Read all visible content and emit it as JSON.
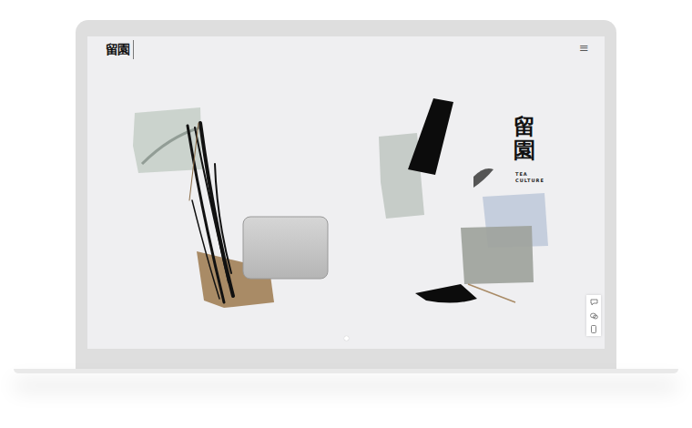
{
  "logo": {
    "text": "留園"
  },
  "menu": {
    "icon": "≡"
  },
  "hero": {
    "title": "留園",
    "subtitle": "TEA CULTURE"
  },
  "pagination": {
    "dots": [
      {
        "selected": true
      }
    ]
  }
}
